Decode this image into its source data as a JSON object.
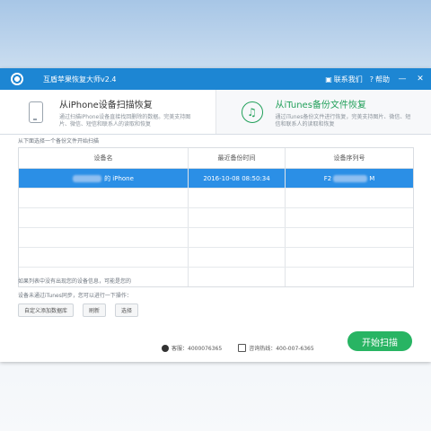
{
  "app": {
    "title": "互盾苹果恢复大师v2.4"
  },
  "titlebar": {
    "contact_label": "联系我们",
    "help_label": "帮助",
    "minimize": "—",
    "close": "✕"
  },
  "tabs": [
    {
      "title": "从iPhone设备扫描恢复",
      "desc": "通过扫描iPhone设备直接找回删除的数据。完美支持图片、微信、短信和联系人的读取和恢复"
    },
    {
      "title": "从iTunes备份文件恢复",
      "desc": "通过iTunes备份文件进行恢复，完美支持图片、微信、短信和联系人的读取和恢复"
    }
  ],
  "main": {
    "hint": "从下面选择一个备份文件开始扫描"
  },
  "table": {
    "headers": [
      "设备名",
      "最近备份时间",
      "设备序列号"
    ],
    "rows": [
      {
        "device": "的 iPhone",
        "time": "2016-10-08  08:50:34",
        "serial_prefix": "F2",
        "serial_suffix": "M"
      }
    ]
  },
  "notes": {
    "line1": "如果列表中没有出现您的设备信息，可能是您的",
    "line2": "设备未通过iTunes同步，您可以进行一下操作："
  },
  "buttons": {
    "custom": "自定义添加数据库",
    "refresh": "刷新",
    "select": "选择",
    "start": "开始扫描"
  },
  "footer": {
    "qq": "客服：4000076365",
    "hotline": "咨询热线：400-007-6365"
  },
  "colors": {
    "brand": "#1d86d3",
    "accent": "#28b463",
    "selected_row": "#2b8fe6"
  }
}
